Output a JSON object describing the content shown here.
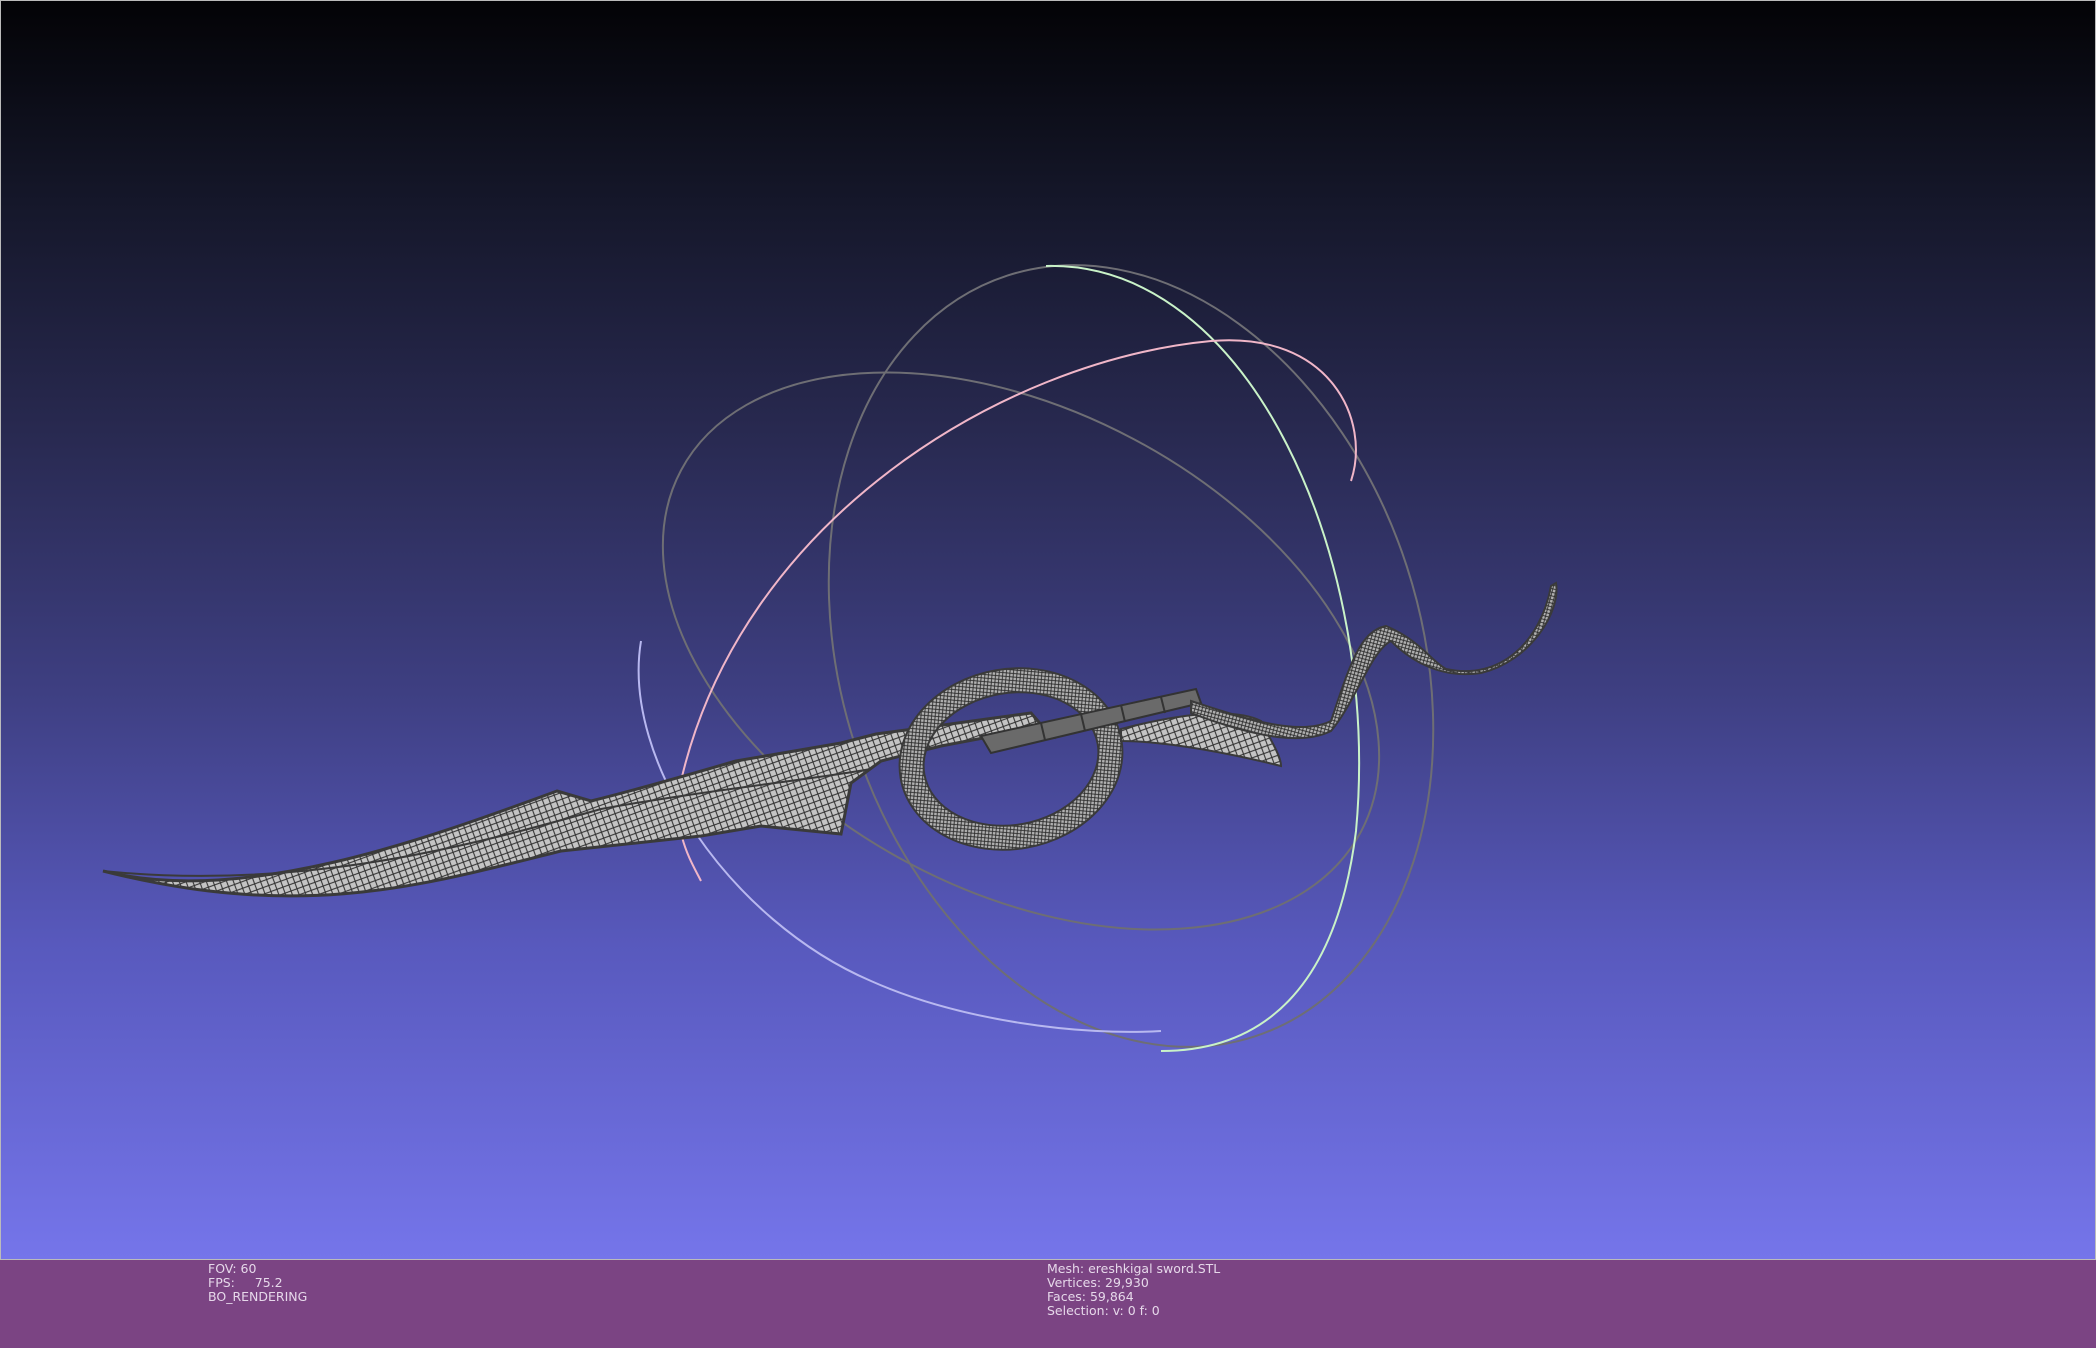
{
  "viewport": {
    "background_top": "#030306",
    "background_bottom": "#7575ea",
    "trackball_colors": {
      "ring_x": "#c9f2c8",
      "ring_y": "#f0b6c8",
      "ring_z": "#b8b8f0",
      "ring_gray": "#6e6e74"
    },
    "mesh_color": "#bdbdbd",
    "wire_color": "#3a3a3a"
  },
  "info_bar": {
    "background": "#7b4483",
    "left": {
      "fov": "FOV: 60",
      "fps_label": "FPS:",
      "fps_value": "75.2",
      "rendering": "BO_RENDERING"
    },
    "right": {
      "mesh": "Mesh: ereshkigal sword.STL",
      "vertices": "Vertices: 29,930",
      "faces": "Faces: 59,864",
      "selection": "Selection: v: 0 f: 0"
    }
  }
}
